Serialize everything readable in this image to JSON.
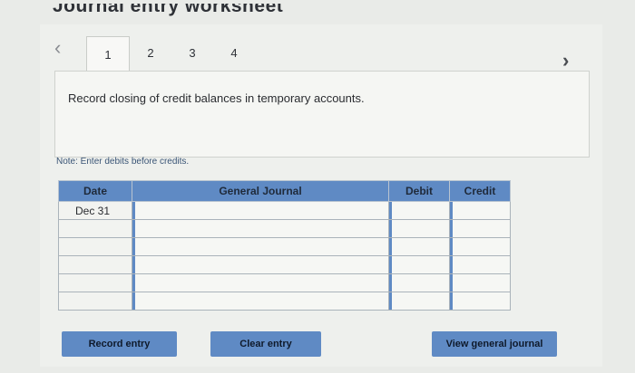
{
  "page": {
    "title": "Journal entry worksheet"
  },
  "pager": {
    "prev_icon": "chevron-left-icon",
    "next_icon": "chevron-right-icon",
    "tabs": [
      "1",
      "2",
      "3",
      "4"
    ],
    "active_tab": "1"
  },
  "instruction": "Record closing of credit balances in temporary accounts.",
  "note": "Note: Enter debits before credits.",
  "table": {
    "headers": {
      "date": "Date",
      "journal": "General Journal",
      "debit": "Debit",
      "credit": "Credit"
    },
    "rows": [
      {
        "date": "Dec 31",
        "journal": "",
        "debit": "",
        "credit": ""
      },
      {
        "date": "",
        "journal": "",
        "debit": "",
        "credit": ""
      },
      {
        "date": "",
        "journal": "",
        "debit": "",
        "credit": ""
      },
      {
        "date": "",
        "journal": "",
        "debit": "",
        "credit": ""
      },
      {
        "date": "",
        "journal": "",
        "debit": "",
        "credit": ""
      },
      {
        "date": "",
        "journal": "",
        "debit": "",
        "credit": ""
      }
    ]
  },
  "buttons": {
    "record": "Record entry",
    "clear": "Clear entry",
    "view": "View general journal"
  },
  "colors": {
    "accent": "#5f8ac4"
  }
}
